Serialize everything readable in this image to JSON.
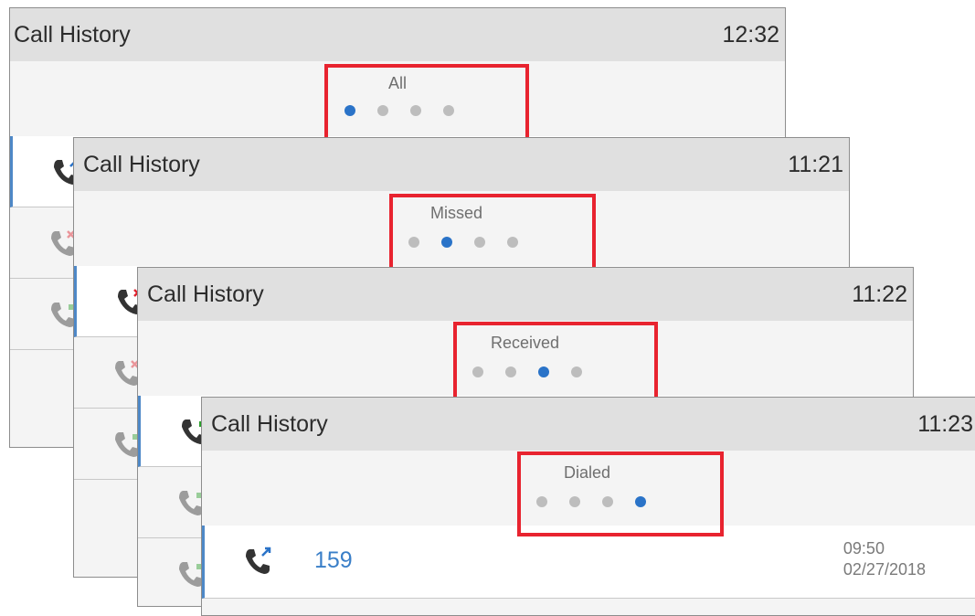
{
  "colors": {
    "accent": "#2a73c8",
    "highlight_box": "#e8232f",
    "header_bg": "#e0e0e0",
    "missed": "#e0232f",
    "received": "#2ca02c"
  },
  "screens": [
    {
      "title": "Call History",
      "time": "12:32",
      "filter": "All",
      "active_dot": 1
    },
    {
      "title": "Call History",
      "time": "11:21",
      "filter": "Missed",
      "active_dot": 2
    },
    {
      "title": "Call History",
      "time": "11:22",
      "filter": "Received",
      "active_dot": 3
    },
    {
      "title": "Call History",
      "time": "11:23",
      "filter": "Dialed",
      "active_dot": 4
    }
  ],
  "dialed_entry": {
    "icon": "dialed-call-icon",
    "number": "159",
    "time": "09:50",
    "date": "02/27/2018"
  }
}
